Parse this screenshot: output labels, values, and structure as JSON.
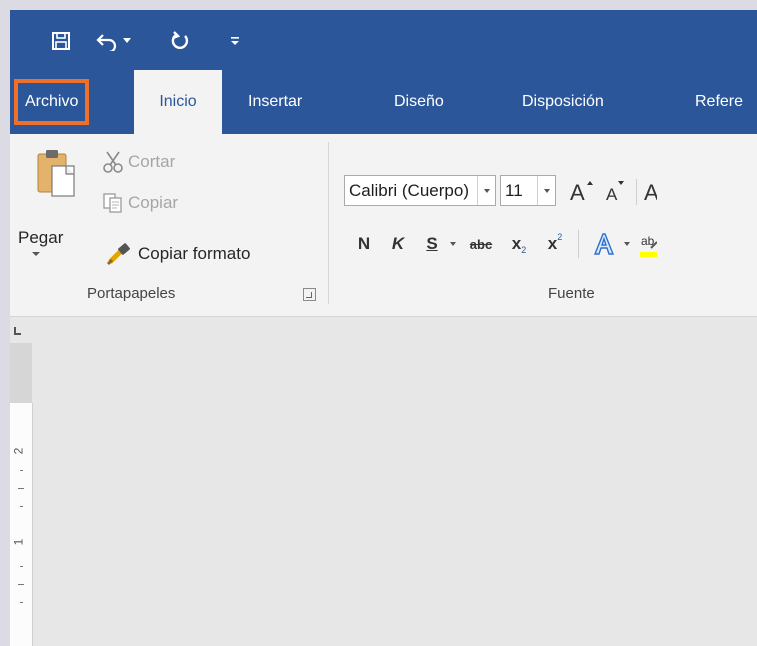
{
  "quick_access": {
    "save_icon": "save-icon",
    "undo_icon": "undo-icon",
    "undo_dropdown_icon": "dropdown-arrow-icon",
    "redo_icon": "redo-icon",
    "customize_icon": "customize-qat-icon"
  },
  "tabs": [
    {
      "label": "Archivo",
      "highlighted": true
    },
    {
      "label": "Inicio",
      "active": true
    },
    {
      "label": "Insertar"
    },
    {
      "label": "Diseño"
    },
    {
      "label": "Disposición"
    },
    {
      "label": "Refere"
    }
  ],
  "ribbon": {
    "clipboard": {
      "paste_label": "Pegar",
      "cut_label": "Cortar",
      "copy_label": "Copiar",
      "format_painter_label": "Copiar formato",
      "group_label": "Portapapeles"
    },
    "font": {
      "font_name": "Calibri (Cuerpo)",
      "font_size": "11",
      "bold": "N",
      "italic": "K",
      "underline": "S",
      "strikethrough": "abc",
      "subscript": "x",
      "superscript": "x",
      "group_label": "Fuente"
    }
  },
  "ruler": {
    "numbers": [
      "2",
      "1"
    ]
  },
  "colors": {
    "title_bar": "#2b579a",
    "highlight_box": "#f0702a",
    "ribbon_bg": "#f3f3f3"
  }
}
